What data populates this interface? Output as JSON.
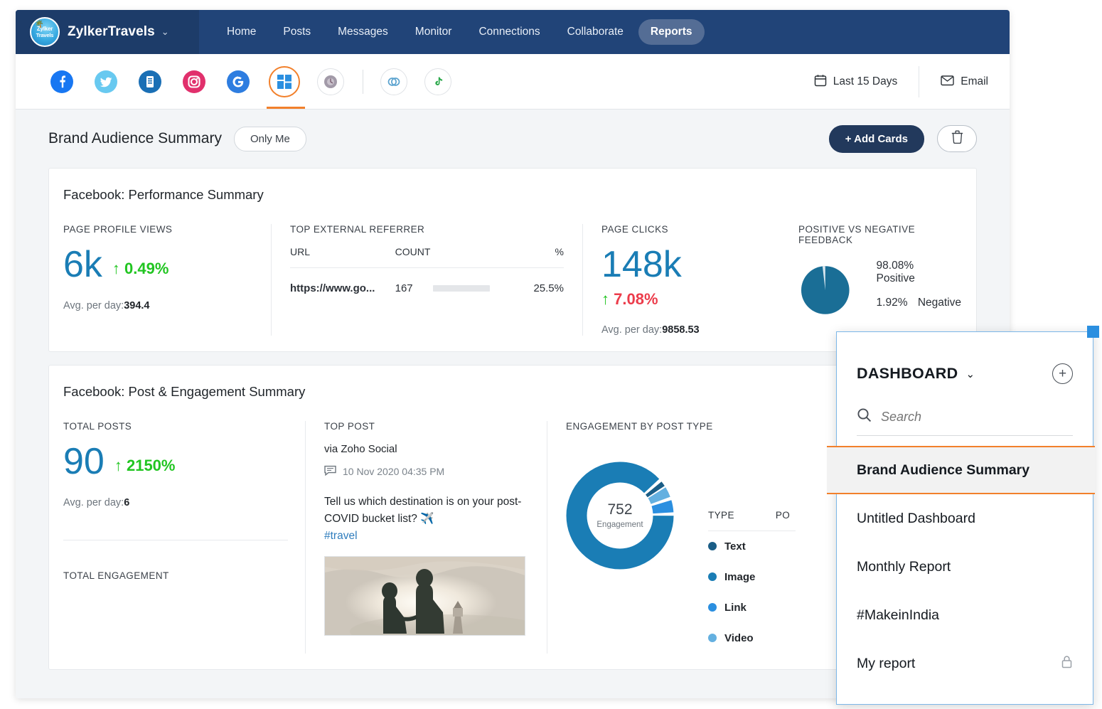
{
  "topnav": {
    "brand": "ZylkerTravels",
    "logo_line1": "Zylker",
    "logo_line2": "Travels",
    "caret": "⌄",
    "items": [
      {
        "label": "Home",
        "active": false
      },
      {
        "label": "Posts",
        "active": false
      },
      {
        "label": "Messages",
        "active": false
      },
      {
        "label": "Monitor",
        "active": false
      },
      {
        "label": "Connections",
        "active": false
      },
      {
        "label": "Collaborate",
        "active": false
      },
      {
        "label": "Reports",
        "active": true
      }
    ]
  },
  "channelbar": {
    "channels": [
      {
        "name": "facebook",
        "glyph": "f",
        "color": "#1877f2",
        "active": false
      },
      {
        "name": "twitter",
        "glyph": "ᴠ",
        "color": "#63c9ef",
        "active": false
      },
      {
        "name": "linkedin",
        "glyph": "in",
        "color": "#1a6fb5",
        "active": false
      },
      {
        "name": "instagram",
        "glyph": "◎",
        "color": "#e1306c",
        "active": false
      },
      {
        "name": "google-my-business",
        "glyph": "G",
        "color": "#2e7de0",
        "active": false
      },
      {
        "name": "dashboard",
        "glyph": "■",
        "color": "#2b8fe0",
        "active": true
      },
      {
        "name": "pinterest",
        "glyph": "◉",
        "color": "#a6a6b4",
        "active": false
      },
      {
        "name": "link",
        "glyph": "∞",
        "color": "#5ba3cf",
        "active": false
      },
      {
        "name": "tiktok",
        "glyph": "♪",
        "color": "#2aa84a",
        "active": false
      }
    ],
    "daterange": "Last 15 Days",
    "email": "Email",
    "calendar_icon": "calendar-icon",
    "email_icon": "envelope-icon"
  },
  "pageheader": {
    "title": "Brand Audience Summary",
    "visibility": "Only Me",
    "add_cards": "+ Add Cards",
    "delete_icon": "trash-icon"
  },
  "card1": {
    "title": "Facebook: Performance Summary",
    "profile_views": {
      "label": "PAGE PROFILE VIEWS",
      "value": "6k",
      "delta": "0.49%",
      "arrow": "↑",
      "avg_label": "Avg. per day:",
      "avg_value": "394.4"
    },
    "referrer": {
      "label": "TOP EXTERNAL REFERRER",
      "headers": [
        "URL",
        "COUNT",
        "%"
      ],
      "rows": [
        {
          "url": "https://www.go...",
          "count": "167",
          "pct": "25.5%",
          "bar": 25.5
        }
      ]
    },
    "page_clicks": {
      "label": "PAGE CLICKS",
      "value": "148k",
      "delta": "7.08%",
      "arrow": "↑",
      "avg_label": "Avg. per day:",
      "avg_value": "9858.53"
    },
    "feedback": {
      "label": "POSITIVE VS NEGATIVE FEEDBACK",
      "items": [
        {
          "pct": "98.08%",
          "name": "Positive",
          "color": "#1a6e96",
          "value": 98.08
        },
        {
          "pct": "1.92%",
          "name": "Negative",
          "color": "#bcd9e8",
          "value": 1.92
        }
      ]
    }
  },
  "card2": {
    "title": "Facebook: Post & Engagement Summary",
    "total_posts": {
      "label": "TOTAL POSTS",
      "value": "90",
      "delta": "2150%",
      "arrow": "↑",
      "avg_label": "Avg. per day:",
      "avg_value": "6"
    },
    "total_engagement_label": "TOTAL ENGAGEMENT",
    "top_post": {
      "label": "TOP POST",
      "via": "via Zoho Social",
      "timestamp": "10 Nov 2020 04:35 PM",
      "comment_icon": "comment-icon",
      "text": "Tell us which destination is on your post-COVID bucket list? ✈️",
      "hashtag": "#travel",
      "image_alt": "couple-silhouette-photo"
    },
    "engagement": {
      "label": "ENGAGEMENT BY POST TYPE",
      "center_value": "752",
      "center_label": "Engagement",
      "headers": [
        "TYPE",
        "PO"
      ],
      "rows": [
        {
          "type": "Text",
          "color": "#1a5d86"
        },
        {
          "type": "Image",
          "color": "#1a7db5"
        },
        {
          "type": "Link",
          "color": "#2b8fe0"
        },
        {
          "type": "Video",
          "color": "#64b0e0"
        }
      ]
    }
  },
  "chart_data": [
    {
      "type": "pie",
      "title": "POSITIVE VS NEGATIVE FEEDBACK",
      "categories": [
        "Positive",
        "Negative"
      ],
      "values": [
        98.08,
        1.92
      ],
      "colors": [
        "#1a6e96",
        "#bcd9e8"
      ],
      "legend": "right",
      "unit": "%"
    },
    {
      "type": "pie",
      "title": "ENGAGEMENT BY POST TYPE",
      "subtitle": "752 Engagement",
      "categories": [
        "Text",
        "Image",
        "Link",
        "Video"
      ],
      "values": [
        88.0,
        5.0,
        3.5,
        3.5
      ],
      "colors": [
        "#1a7db5",
        "#2b8fe0",
        "#64b0e0",
        "#1a5d86"
      ],
      "legend": "right",
      "donut": true
    },
    {
      "type": "bar",
      "title": "TOP EXTERNAL REFERRER",
      "categories": [
        "https://www.go..."
      ],
      "values": [
        25.5
      ],
      "ylim": [
        0,
        100
      ],
      "ylabel": "%",
      "grid": false
    }
  ],
  "dashboard_panel": {
    "title": "DASHBOARD",
    "chevron": "⌄",
    "add_icon": "plus-circle-icon",
    "search_placeholder": "Search",
    "search_value": "",
    "search_icon": "search-icon",
    "items": [
      {
        "label": "Brand Audience Summary",
        "selected": true,
        "locked": false
      },
      {
        "label": "Untitled Dashboard",
        "selected": false,
        "locked": false
      },
      {
        "label": "Monthly Report",
        "selected": false,
        "locked": false
      },
      {
        "label": "#MakeinIndia",
        "selected": false,
        "locked": false
      },
      {
        "label": "My report",
        "selected": false,
        "locked": true
      }
    ],
    "lock_icon": "lock-icon",
    "accent_color": "#f2802b",
    "border_color": "#7cb7e8"
  }
}
